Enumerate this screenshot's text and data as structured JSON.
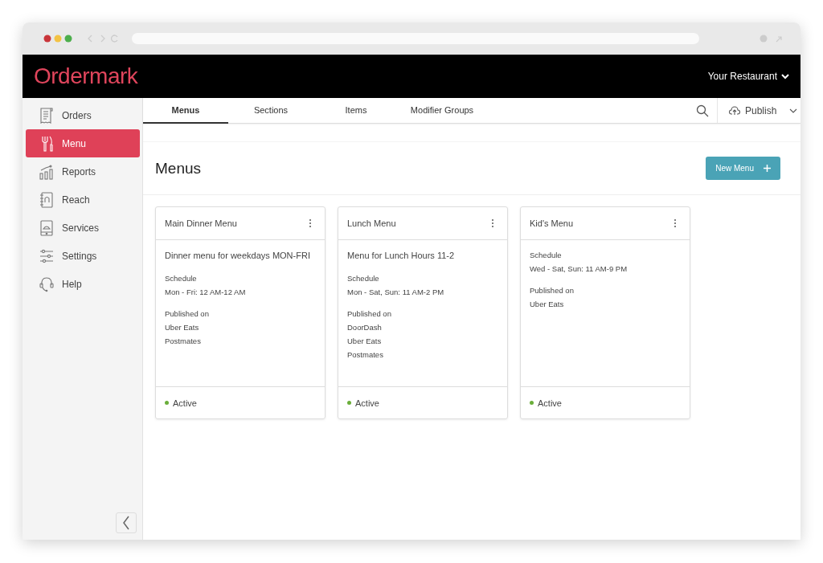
{
  "brand": {
    "logo": "Ordermark"
  },
  "header": {
    "account": "Your Restaurant"
  },
  "sidebar": {
    "items": [
      {
        "label": "Orders",
        "kind": "orders",
        "selected": false
      },
      {
        "label": "Menu",
        "kind": "menu",
        "selected": true
      },
      {
        "label": "Reports",
        "kind": "reports",
        "selected": false
      },
      {
        "label": "Reach",
        "kind": "reach",
        "selected": false
      },
      {
        "label": "Services",
        "kind": "services",
        "selected": false
      },
      {
        "label": "Settings",
        "kind": "settings",
        "selected": false
      },
      {
        "label": "Help",
        "kind": "help",
        "selected": false
      }
    ]
  },
  "tabs": [
    {
      "label": "Menus",
      "selected": true
    },
    {
      "label": "Sections",
      "selected": false
    },
    {
      "label": "Items",
      "selected": false
    },
    {
      "label": "Modifier Groups",
      "selected": false
    }
  ],
  "toolbar": {
    "publish": "Publish"
  },
  "page": {
    "title": "Menus",
    "new_button": "New Menu"
  },
  "cards": [
    {
      "title": "Main Dinner Menu",
      "description": "Dinner menu for weekdays MON-FRI",
      "schedule_label": "Schedule",
      "schedule": "Mon - Fri: 12 AM-12 AM",
      "published_label": "Published on",
      "platforms": [
        "Uber Eats",
        "Postmates"
      ],
      "status": "Active"
    },
    {
      "title": "Lunch Menu",
      "description": "Menu for Lunch Hours 11-2",
      "schedule_label": "Schedule",
      "schedule": "Mon - Sat, Sun: 11 AM-2 PM",
      "published_label": "Published on",
      "platforms": [
        "DoorDash",
        "Uber Eats",
        "Postmates"
      ],
      "status": "Active"
    },
    {
      "title": "Kid's Menu",
      "schedule_label": "Schedule",
      "schedule": "Wed - Sat, Sun: 11 AM-9 PM",
      "published_label": "Published on",
      "platforms": [
        "Uber Eats"
      ],
      "status": "Active"
    }
  ]
}
